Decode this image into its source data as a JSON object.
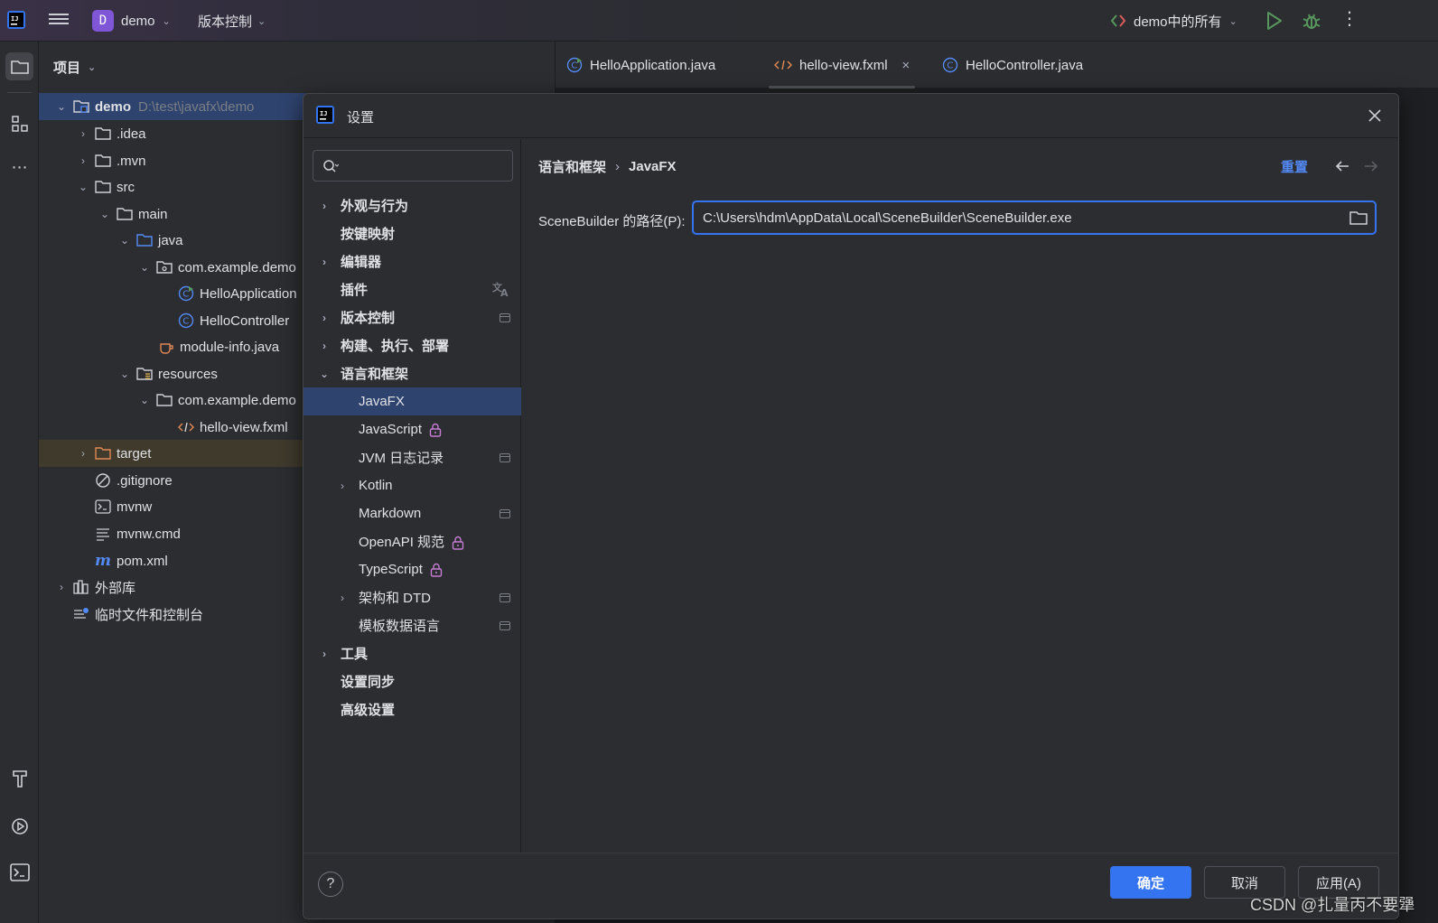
{
  "titlebar": {
    "project_initial": "D",
    "project_name": "demo",
    "vcs_label": "版本控制",
    "run_config": "demo中的所有"
  },
  "project_panel": {
    "header": "项目",
    "tree": [
      {
        "label": "demo",
        "path": "D:\\test\\javafx\\demo"
      },
      {
        "label": ".idea"
      },
      {
        "label": ".mvn"
      },
      {
        "label": "src"
      },
      {
        "label": "main"
      },
      {
        "label": "java"
      },
      {
        "label": "com.example.demo"
      },
      {
        "label": "HelloApplication"
      },
      {
        "label": "HelloController"
      },
      {
        "label": "module-info.java"
      },
      {
        "label": "resources"
      },
      {
        "label": "com.example.demo"
      },
      {
        "label": "hello-view.fxml"
      },
      {
        "label": "target"
      },
      {
        "label": ".gitignore"
      },
      {
        "label": "mvnw"
      },
      {
        "label": "mvnw.cmd"
      },
      {
        "label": "pom.xml"
      },
      {
        "label": "外部库"
      },
      {
        "label": "临时文件和控制台"
      }
    ]
  },
  "editor_tabs": [
    {
      "label": "HelloApplication.java"
    },
    {
      "label": "hello-view.fxml",
      "close": "×"
    },
    {
      "label": "HelloController.java"
    }
  ],
  "settings_dialog": {
    "title": "设置",
    "search_placeholder": "",
    "nav": [
      {
        "label": "外观与行为"
      },
      {
        "label": "按键映射"
      },
      {
        "label": "编辑器"
      },
      {
        "label": "插件"
      },
      {
        "label": "版本控制"
      },
      {
        "label": "构建、执行、部署"
      },
      {
        "label": "语言和框架"
      },
      {
        "label": "JavaFX"
      },
      {
        "label": "JavaScript"
      },
      {
        "label": "JVM 日志记录"
      },
      {
        "label": "Kotlin"
      },
      {
        "label": "Markdown"
      },
      {
        "label": "OpenAPI 规范"
      },
      {
        "label": "TypeScript"
      },
      {
        "label": "架构和 DTD"
      },
      {
        "label": "模板数据语言"
      },
      {
        "label": "工具"
      },
      {
        "label": "设置同步"
      },
      {
        "label": "高级设置"
      }
    ],
    "breadcrumb": [
      "语言和框架",
      "JavaFX"
    ],
    "breadcrumb_sep": "›",
    "reset_label": "重置",
    "scenebuilder_label": "SceneBuilder 的路径(P):",
    "scenebuilder_path": "C:\\Users\\hdm\\AppData\\Local\\SceneBuilder\\SceneBuilder.exe",
    "help": "?",
    "ok_label": "确定",
    "cancel_label": "取消",
    "apply_label": "应用(A)"
  },
  "watermark": "CSDN @扎量丙不要犟",
  "colors": {
    "accent": "#3574f0",
    "selection": "#2e436e",
    "panel": "#2b2d30",
    "editor": "#1e1f22"
  }
}
